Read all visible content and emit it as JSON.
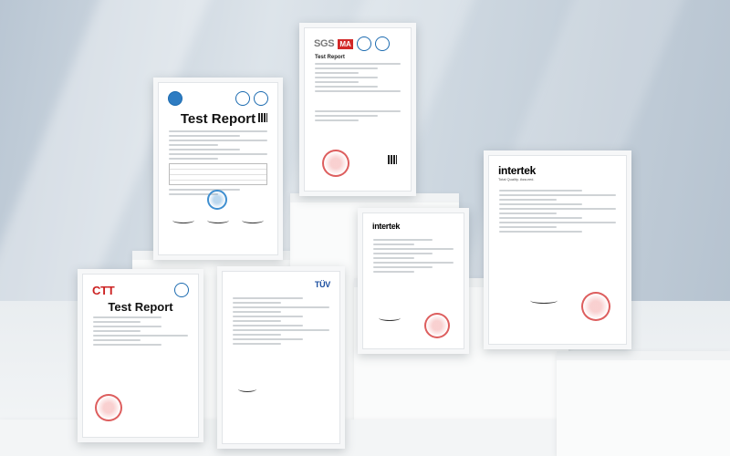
{
  "scene": {
    "description_labels": {
      "cert_a_title": "Test Report",
      "cert_b_logo": "SGS",
      "cert_b_title": "Test Report",
      "cert_c_logo": "intertek",
      "cert_d_logo": "CTT",
      "cert_d_title": "Test Report",
      "cert_e_logo": "TÜV",
      "cert_f_logo": "intertek",
      "cert_f_sub": "Total Quality. Assured."
    }
  },
  "colors": {
    "stamp_red": "#d22828",
    "accent_blue": "#1c6bb0",
    "intertek_yellow": "#f2c400"
  }
}
